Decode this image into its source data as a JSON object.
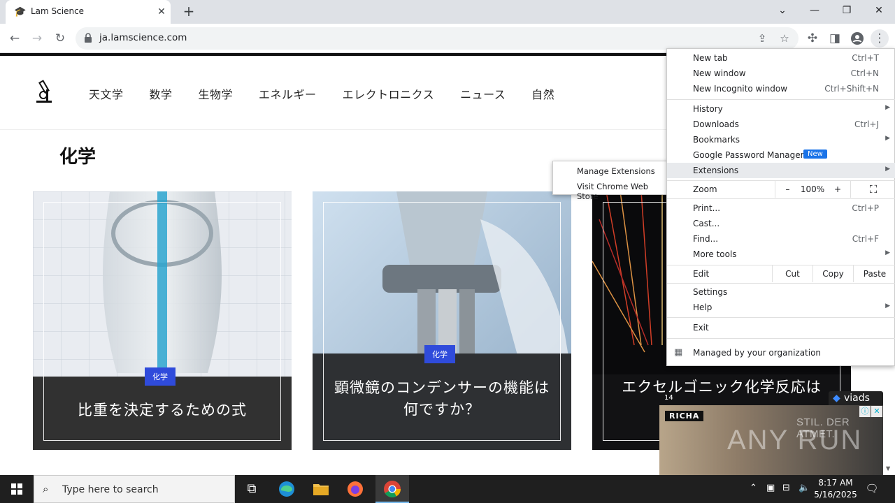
{
  "browser": {
    "tab_title": "Lam Science",
    "tab_favicon": "graduation-cap-icon",
    "url": "ja.lamscience.com",
    "new_tab_symbol": "+",
    "close_symbol": "✕",
    "window_controls": {
      "dropdown": "⌄",
      "minimize": "—",
      "restore": "❐",
      "close": "✕"
    }
  },
  "site": {
    "nav": [
      "天文学",
      "数学",
      "生物学",
      "エネルギー",
      "エレクトロニクス",
      "ニュース",
      "自然"
    ],
    "page_title": "化学",
    "cards": [
      {
        "badge": "化学",
        "title": "比重を決定するための式"
      },
      {
        "badge": "化学",
        "title": "顕微鏡のコンデンサーの機能は何ですか？"
      },
      {
        "badge": "化学",
        "title": "エクセルゴニック化学反応は"
      }
    ]
  },
  "menu": {
    "items": [
      {
        "label": "New tab",
        "shortcut": "Ctrl+T"
      },
      {
        "label": "New window",
        "shortcut": "Ctrl+N"
      },
      {
        "label": "New Incognito window",
        "shortcut": "Ctrl+Shift+N"
      },
      {
        "label": "History",
        "submenu": true
      },
      {
        "label": "Downloads",
        "shortcut": "Ctrl+J"
      },
      {
        "label": "Bookmarks",
        "submenu": true
      },
      {
        "label": "Google Password Manager",
        "badge": "New"
      },
      {
        "label": "Extensions",
        "submenu": true
      },
      {
        "label": "Print...",
        "shortcut": "Ctrl+P"
      },
      {
        "label": "Cast..."
      },
      {
        "label": "Find...",
        "shortcut": "Ctrl+F"
      },
      {
        "label": "More tools",
        "submenu": true
      },
      {
        "label": "Settings"
      },
      {
        "label": "Help",
        "submenu": true
      },
      {
        "label": "Exit"
      }
    ],
    "zoom": {
      "label": "Zoom",
      "minus": "–",
      "value": "100%",
      "plus": "+",
      "fullscreen": "⛶"
    },
    "edit": {
      "label": "Edit",
      "cut": "Cut",
      "copy": "Copy",
      "paste": "Paste"
    },
    "managed": "Managed by your organization",
    "submenu_arrow": "▶"
  },
  "extensions_submenu": [
    "Manage Extensions",
    "Visit Chrome Web Store"
  ],
  "ad": {
    "brand": "RICHA",
    "slogan": "STIL. DER ATMET.",
    "network": "viads",
    "count": "14",
    "info": "ⓘ",
    "close": "✕",
    "watermark": "ANY RUN"
  },
  "taskbar": {
    "search_placeholder": "Type here to search",
    "time": "8:17 AM",
    "date": "5/16/2025"
  },
  "colors": {
    "accent": "#2f4bdb",
    "menu_badge": "#1a73e8"
  }
}
